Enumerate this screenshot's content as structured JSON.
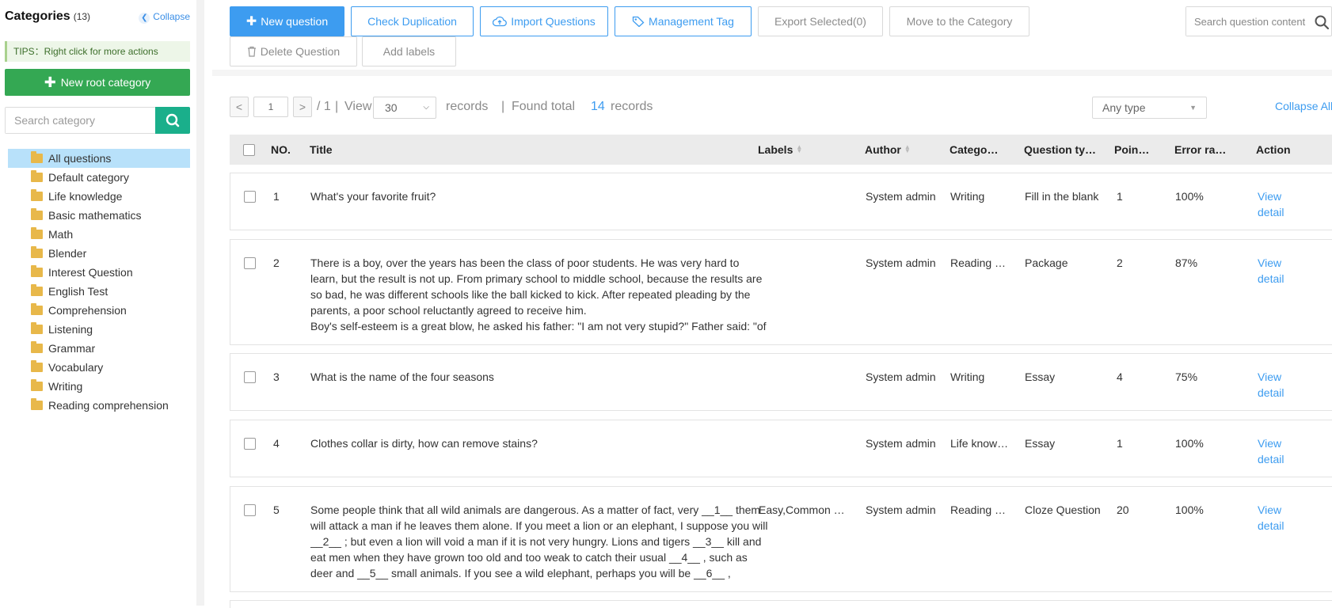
{
  "sidebar": {
    "title": "Categories",
    "count": "(13)",
    "collapse_label": "Collapse",
    "tips": "TIPS：Right click for more actions",
    "new_root_label": "New root category",
    "search_placeholder": "Search category",
    "categories": [
      {
        "label": "All questions",
        "active": true
      },
      {
        "label": "Default category"
      },
      {
        "label": "Life knowledge"
      },
      {
        "label": "Basic mathematics"
      },
      {
        "label": "Math"
      },
      {
        "label": "Blender"
      },
      {
        "label": "Interest Question"
      },
      {
        "label": "English Test"
      },
      {
        "label": "Comprehension"
      },
      {
        "label": "Listening"
      },
      {
        "label": "Grammar"
      },
      {
        "label": "Vocabulary"
      },
      {
        "label": "Writing"
      },
      {
        "label": "Reading comprehension"
      }
    ]
  },
  "toolbar": {
    "new_question": "New question",
    "check_duplication": "Check Duplication",
    "import_questions": "Import Questions",
    "management_tag": "Management Tag",
    "export_selected": "Export Selected(0)",
    "move_to_category": "Move to the Category",
    "delete_question": "Delete Question",
    "add_labels": "Add labels",
    "search_placeholder": "Search question content"
  },
  "pager": {
    "prev": "<",
    "next": ">",
    "page": "1",
    "of_total": "/ 1",
    "sep1": "|",
    "view": "View",
    "per_page": "30",
    "records": "records",
    "sep2": "|",
    "found_total": "Found total",
    "count": "14",
    "records2": "records"
  },
  "filter": {
    "type_selected": "Any type",
    "collapse_all": "Collapse All"
  },
  "table": {
    "columns": {
      "no": "NO.",
      "title": "Title",
      "labels": "Labels",
      "author": "Author",
      "category": "Catego…",
      "question_type": "Question ty…",
      "points": "Poin…",
      "error_rate": "Error ra…",
      "action": "Action"
    },
    "rows": [
      {
        "no": "1",
        "title": "What's your favorite fruit?",
        "labels": "",
        "author": "System admin",
        "category": "Writing",
        "type": "Fill in the blank",
        "points": "1",
        "error_rate": "100%",
        "action": "View detail"
      },
      {
        "no": "2",
        "title": "There is a boy, over the years has been the class of poor students. He was very hard to learn, but the result is not up. From primary school to middle school, because the results are so bad, he was different schools like the ball kicked to kick. After repeated pleading by the parents, a poor school reluctantly agreed to receive him.",
        "title2": "Boy's self-esteem is a great blow, he asked his father: \"I am not very stupid?\" Father said: \"of",
        "labels": "",
        "author": "System admin",
        "category": "Reading …",
        "type": "Package",
        "points": "2",
        "error_rate": "87%",
        "action": "View detail"
      },
      {
        "no": "3",
        "title": "What is the name of the four seasons",
        "labels": "",
        "author": "System admin",
        "category": "Writing",
        "type": "Essay",
        "points": "4",
        "error_rate": "75%",
        "action": "View detail"
      },
      {
        "no": "4",
        "title": "Clothes collar is dirty, how can remove stains?",
        "labels": "",
        "author": "System admin",
        "category": "Life know…",
        "type": "Essay",
        "points": "1",
        "error_rate": "100%",
        "action": "View detail"
      },
      {
        "no": "5",
        "title": "Some people think that all wild animals are dangerous. As a matter of fact, very __1__ them will attack a man if he leaves them alone. If you meet a lion or an elephant, I suppose you will __2__ ; but even a lion will void a man if it is not very hungry. Lions and tigers __3__ kill and eat men when they have grown too old and too weak to catch their usual __4__ , such as deer and __5__ small animals. If you see a wild elephant, perhaps you will be __6__ ,",
        "labels": "Easy,Common …",
        "author": "System admin",
        "category": "Reading …",
        "type": "Cloze Question",
        "points": "20",
        "error_rate": "100%",
        "action": "View detail"
      }
    ]
  },
  "colors": {
    "primary": "#3d9cf0",
    "green": "#34a853",
    "teal": "#1aaf8b",
    "active_category": "#b8e1fa"
  }
}
